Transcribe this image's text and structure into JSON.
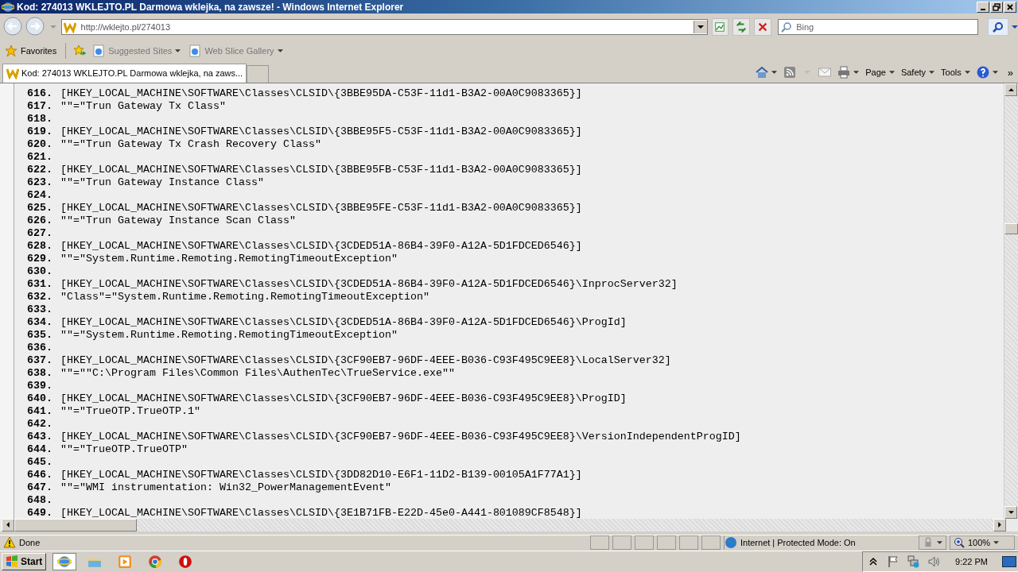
{
  "window": {
    "title": "Kod: 274013 WKLEJTO.PL Darmowa wklejka, na zawsze! - Windows Internet Explorer"
  },
  "address_bar": {
    "url": "http://wklejto.pl/274013"
  },
  "search": {
    "placeholder": "Bing"
  },
  "favorites_bar": {
    "favorites": "Favorites",
    "links": [
      "Suggested Sites",
      "Web Slice Gallery"
    ]
  },
  "tabs": [
    {
      "label": "Kod: 274013 WKLEJTO.PL Darmowa wklejka, na zaws...",
      "selected": true
    }
  ],
  "command_bar": {
    "menus": [
      "Page",
      "Safety",
      "Tools"
    ],
    "overflow": "»"
  },
  "code_lines": [
    {
      "number": "616.",
      "text": "[HKEY_LOCAL_MACHINE\\SOFTWARE\\Classes\\CLSID\\{3BBE95DA-C53F-11d1-B3A2-00A0C9083365}]"
    },
    {
      "number": "617.",
      "text": "\"\"=\"Trun Gateway Tx Class\""
    },
    {
      "number": "618."
    },
    {
      "number": "619.",
      "text": "[HKEY_LOCAL_MACHINE\\SOFTWARE\\Classes\\CLSID\\{3BBE95F5-C53F-11d1-B3A2-00A0C9083365}]"
    },
    {
      "number": "620.",
      "text": "\"\"=\"Trun Gateway Tx Crash Recovery Class\""
    },
    {
      "number": "621."
    },
    {
      "number": "622.",
      "text": "[HKEY_LOCAL_MACHINE\\SOFTWARE\\Classes\\CLSID\\{3BBE95FB-C53F-11d1-B3A2-00A0C9083365}]"
    },
    {
      "number": "623.",
      "text": "\"\"=\"Trun Gateway Instance Class\""
    },
    {
      "number": "624."
    },
    {
      "number": "625.",
      "text": "[HKEY_LOCAL_MACHINE\\SOFTWARE\\Classes\\CLSID\\{3BBE95FE-C53F-11d1-B3A2-00A0C9083365}]"
    },
    {
      "number": "626.",
      "text": "\"\"=\"Trun Gateway Instance Scan Class\""
    },
    {
      "number": "627."
    },
    {
      "number": "628.",
      "text": "[HKEY_LOCAL_MACHINE\\SOFTWARE\\Classes\\CLSID\\{3CDED51A-86B4-39F0-A12A-5D1FDCED6546}]"
    },
    {
      "number": "629.",
      "text": "\"\"=\"System.Runtime.Remoting.RemotingTimeoutException\""
    },
    {
      "number": "630."
    },
    {
      "number": "631.",
      "text": "[HKEY_LOCAL_MACHINE\\SOFTWARE\\Classes\\CLSID\\{3CDED51A-86B4-39F0-A12A-5D1FDCED6546}\\InprocServer32]"
    },
    {
      "number": "632.",
      "text": "\"Class\"=\"System.Runtime.Remoting.RemotingTimeoutException\""
    },
    {
      "number": "633."
    },
    {
      "number": "634.",
      "text": "[HKEY_LOCAL_MACHINE\\SOFTWARE\\Classes\\CLSID\\{3CDED51A-86B4-39F0-A12A-5D1FDCED6546}\\ProgId]"
    },
    {
      "number": "635.",
      "text": "\"\"=\"System.Runtime.Remoting.RemotingTimeoutException\""
    },
    {
      "number": "636."
    },
    {
      "number": "637.",
      "text": "[HKEY_LOCAL_MACHINE\\SOFTWARE\\Classes\\CLSID\\{3CF90EB7-96DF-4EEE-B036-C93F495C9EE8}\\LocalServer32]"
    },
    {
      "number": "638.",
      "text": "\"\"=\"\"C:\\Program Files\\Common Files\\AuthenTec\\TrueService.exe\"\""
    },
    {
      "number": "639."
    },
    {
      "number": "640.",
      "text": "[HKEY_LOCAL_MACHINE\\SOFTWARE\\Classes\\CLSID\\{3CF90EB7-96DF-4EEE-B036-C93F495C9EE8}\\ProgID]"
    },
    {
      "number": "641.",
      "text": "\"\"=\"TrueOTP.TrueOTP.1\""
    },
    {
      "number": "642."
    },
    {
      "number": "643.",
      "text": "[HKEY_LOCAL_MACHINE\\SOFTWARE\\Classes\\CLSID\\{3CF90EB7-96DF-4EEE-B036-C93F495C9EE8}\\VersionIndependentProgID]"
    },
    {
      "number": "644.",
      "text": "\"\"=\"TrueOTP.TrueOTP\""
    },
    {
      "number": "645."
    },
    {
      "number": "646.",
      "text": "[HKEY_LOCAL_MACHINE\\SOFTWARE\\Classes\\CLSID\\{3DD82D10-E6F1-11D2-B139-00105A1F77A1}]"
    },
    {
      "number": "647.",
      "text": "\"\"=\"WMI instrumentation: Win32_PowerManagementEvent\""
    },
    {
      "number": "648."
    },
    {
      "number": "649.",
      "text": "[HKEY_LOCAL_MACHINE\\SOFTWARE\\Classes\\CLSID\\{3E1B71FB-E22D-45e0-A441-801089CF8548}]"
    }
  ],
  "status_bar": {
    "status": "Done",
    "zone": "Internet | Protected Mode: On",
    "zoom": "100%"
  },
  "taskbar": {
    "start": "Start",
    "clock": "9:22 PM"
  }
}
